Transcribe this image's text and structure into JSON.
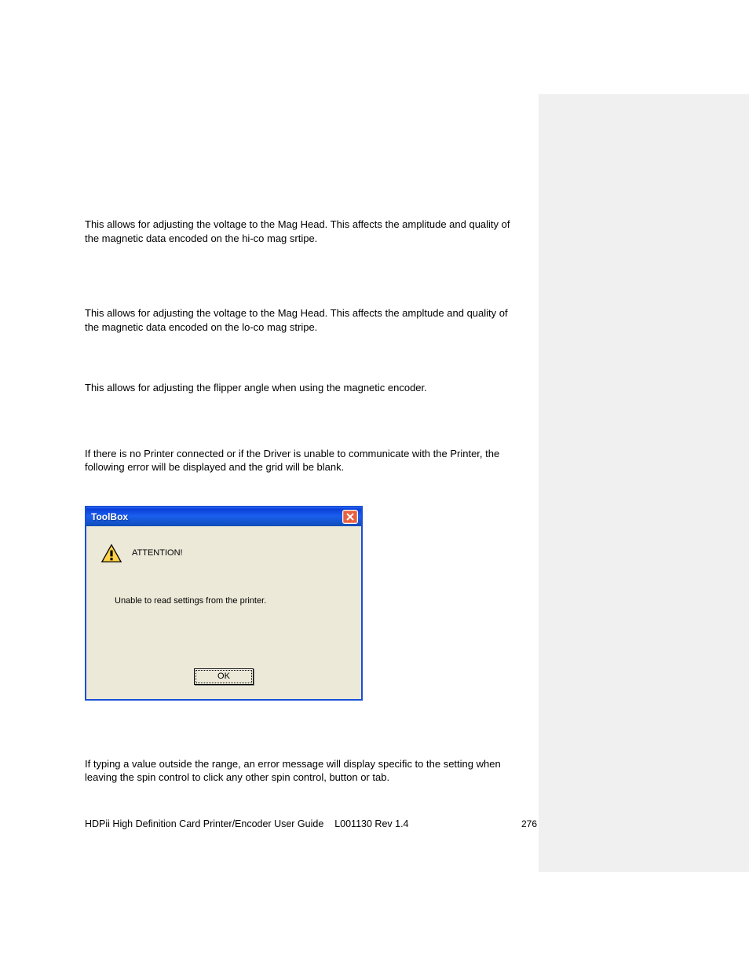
{
  "paragraphs": {
    "p1": "This allows for adjusting the voltage to the Mag Head. This affects the amplitude and quality of the magnetic data encoded on the hi-co mag srtipe.",
    "p2": "This allows for adjusting the voltage to the Mag Head. This affects the ampltude and quality of the magnetic data encoded on the lo-co mag stripe.",
    "p3": "This allows for adjusting the flipper angle when using the magnetic encoder.",
    "p4": "If there is no Printer connected or if the Driver is unable to communicate with the Printer, the following error will be displayed and the grid will be blank.",
    "p5": "If typing a value outside the range, an error message will display specific to the setting when leaving the spin control to click any other spin control, button or tab."
  },
  "dialog": {
    "title": "ToolBox",
    "attention": "ATTENTION!",
    "message": "Unable to read settings from the printer.",
    "ok": "OK"
  },
  "footer": {
    "doc_title": "HDPii High Definition Card Printer/Encoder User Guide",
    "doc_rev": "L001130 Rev 1.4",
    "page": "276"
  }
}
